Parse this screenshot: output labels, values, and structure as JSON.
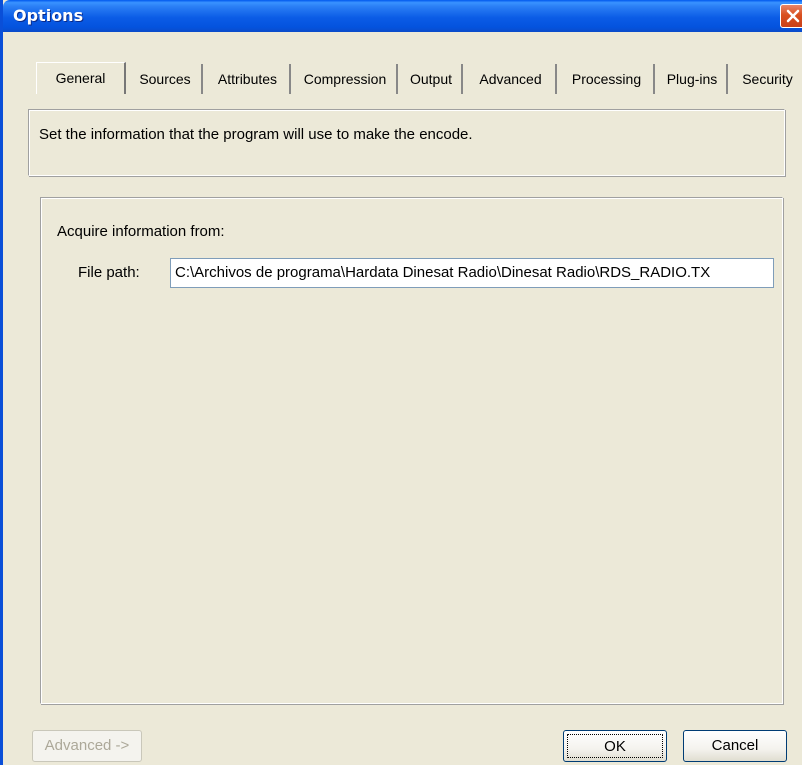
{
  "window": {
    "title": "Options",
    "close_icon": "close-icon"
  },
  "tabs": [
    {
      "label": "General",
      "active": true
    },
    {
      "label": "Sources",
      "active": false
    },
    {
      "label": "Attributes",
      "active": false
    },
    {
      "label": "Compression",
      "active": false
    },
    {
      "label": "Output",
      "active": false
    },
    {
      "label": "Advanced",
      "active": false
    },
    {
      "label": "Processing",
      "active": false
    },
    {
      "label": "Plug-ins",
      "active": false
    },
    {
      "label": "Security",
      "active": false
    }
  ],
  "description": "Set the information that the program will use to make the encode.",
  "acquire": {
    "group_label": "Acquire information from:",
    "file_path_label": "File path:",
    "file_path_value": "C:\\Archivos de programa\\Hardata Dinesat Radio\\Dinesat Radio\\RDS_RADIO.TX"
  },
  "buttons": {
    "advanced": "Advanced ->",
    "ok": "OK",
    "cancel": "Cancel"
  },
  "colors": {
    "title_bar": "#0b5ce6",
    "close_button": "#d9501f",
    "dialog_background": "#ece9d8"
  }
}
